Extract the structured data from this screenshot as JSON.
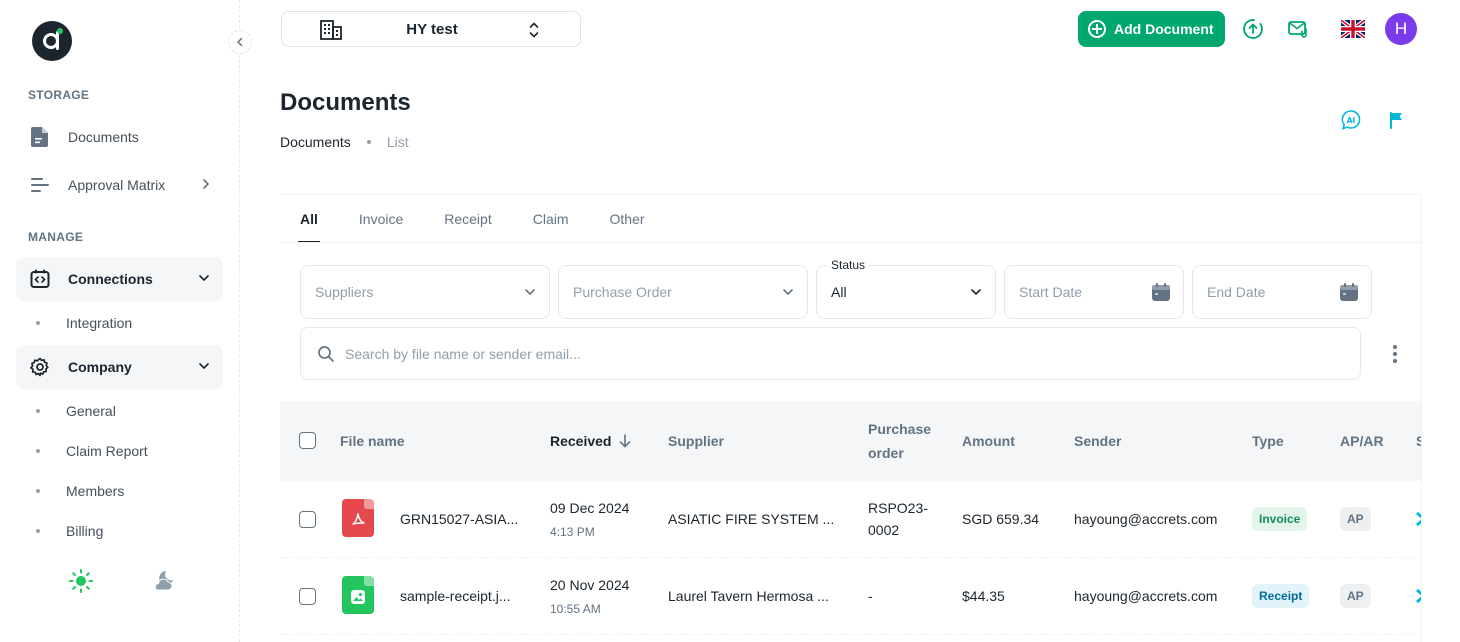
{
  "sidebar": {
    "sections": {
      "storage": "STORAGE",
      "manage": "MANAGE"
    },
    "items": {
      "documents": "Documents",
      "approval_matrix": "Approval Matrix",
      "connections": "Connections",
      "integration": "Integration",
      "company": "Company",
      "general": "General",
      "claim_report": "Claim Report",
      "members": "Members",
      "billing": "Billing"
    }
  },
  "header": {
    "workspace": "HY test",
    "add_document": "Add Document",
    "avatar_initial": "H"
  },
  "page": {
    "title": "Documents",
    "breadcrumb": [
      "Documents",
      "List"
    ]
  },
  "tabs": [
    "All",
    "Invoice",
    "Receipt",
    "Claim",
    "Other"
  ],
  "filters": {
    "suppliers_placeholder": "Suppliers",
    "purchase_order_placeholder": "Purchase Order",
    "status_label": "Status",
    "status_value": "All",
    "start_date_placeholder": "Start Date",
    "end_date_placeholder": "End Date",
    "search_placeholder": "Search by file name or sender email..."
  },
  "table": {
    "columns": {
      "file_name": "File name",
      "received": "Received",
      "supplier": "Supplier",
      "purchase_order_line1": "Purchase",
      "purchase_order_line2": "order",
      "amount": "Amount",
      "sender": "Sender",
      "type": "Type",
      "ap_ar": "AP/AR",
      "status": "S"
    },
    "rows": [
      {
        "file_name": "GRN15027-ASIA...",
        "file_type": "pdf",
        "received_date": "09 Dec 2024",
        "received_time": "4:13 PM",
        "supplier": "ASIATIC FIRE SYSTEM ...",
        "po_line1": "RSPO23-",
        "po_line2": "0002",
        "amount": "SGD 659.34",
        "sender": "hayoung@accrets.com",
        "type": "Invoice",
        "ap_ar": "AP"
      },
      {
        "file_name": "sample-receipt.j...",
        "file_type": "image",
        "received_date": "20 Nov 2024",
        "received_time": "10:55 AM",
        "supplier": "Laurel Tavern Hermosa ...",
        "po_line1": "-",
        "po_line2": "",
        "amount": "$44.35",
        "sender": "hayoung@accrets.com",
        "type": "Receipt",
        "ap_ar": "AP"
      }
    ]
  },
  "colors": {
    "primary": "#00a76f",
    "avatar": "#7c3aed",
    "pdf_icon": "#e5484d",
    "image_icon": "#22c55e",
    "info_icon": "#00b8d9"
  }
}
